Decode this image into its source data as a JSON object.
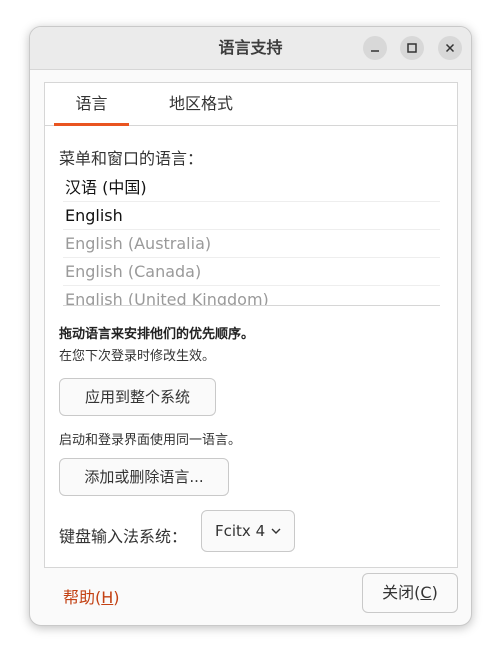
{
  "window": {
    "title": "语言支持",
    "controls": {
      "minimize": "minimize",
      "maximize": "maximize",
      "close": "close"
    }
  },
  "tabs": [
    {
      "label": "语言",
      "selected": true
    },
    {
      "label": "地区格式",
      "selected": false
    }
  ],
  "language": {
    "menus_label": "菜单和窗口的语言：",
    "list": [
      "汉语 (中国)",
      "English",
      "English (Australia)",
      "English (Canada)",
      "English (United Kingdom)"
    ],
    "drag_hint": "拖动语言来安排他们的优先顺序。",
    "effect_hint": "在您下次登录时修改生效。",
    "apply_button": "应用到整个系统",
    "login_hint": "启动和登录界面使用同一语言。",
    "add_remove_button": "添加或删除语言..."
  },
  "keyboard": {
    "label": "键盘输入法系统：",
    "selected": "Fcitx 4"
  },
  "footer": {
    "help_prefix": "帮助(",
    "help_key": "H",
    "help_suffix": ")",
    "close_prefix": "关闭(",
    "close_key": "C",
    "close_suffix": ")"
  },
  "colors": {
    "accent": "#e95420",
    "link": "#c34113"
  }
}
